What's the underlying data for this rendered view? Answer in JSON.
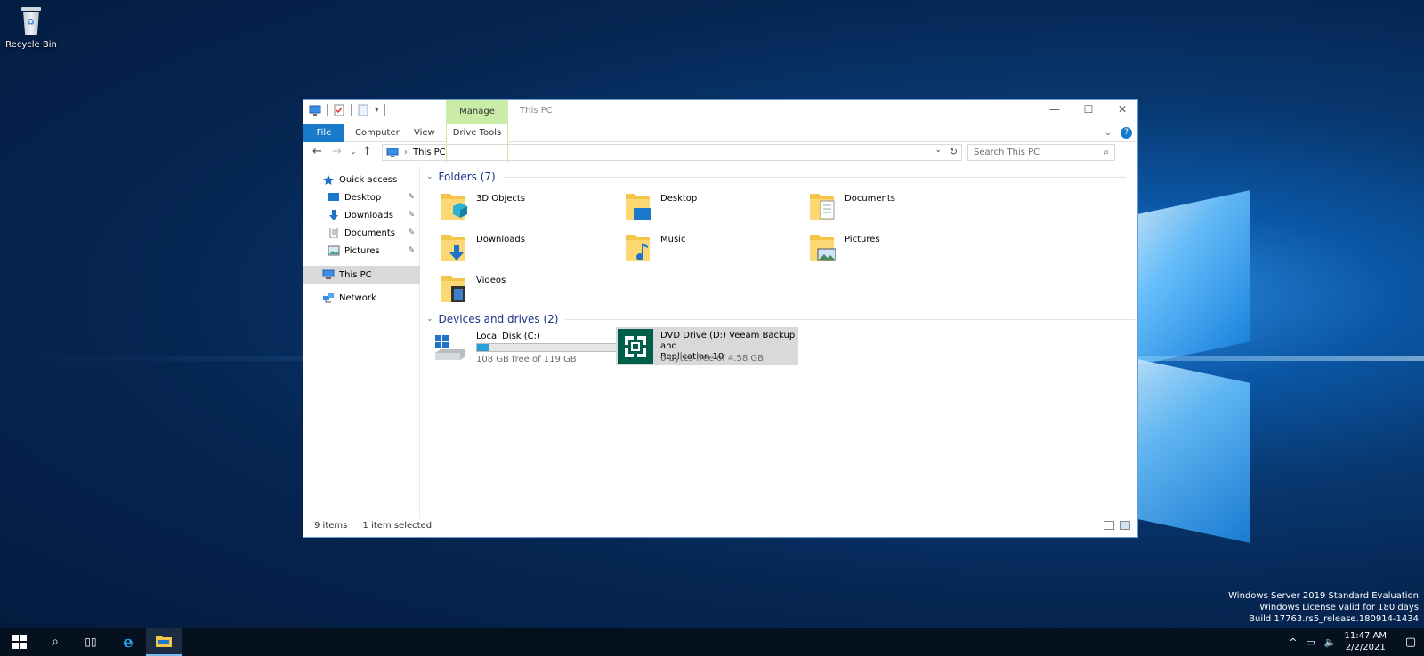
{
  "desktop": {
    "recycle_bin_label": "Recycle Bin",
    "watermark": {
      "line1": "Windows Server 2019 Standard Evaluation",
      "line2": "Windows License valid for 180 days",
      "line3": "Build 17763.rs5_release.180914-1434"
    }
  },
  "window": {
    "title": "This PC",
    "contextual_tab_group": "Manage",
    "ribbon_tabs": {
      "file": "File",
      "computer": "Computer",
      "view": "View",
      "drive_tools": "Drive Tools"
    },
    "controls": {
      "minimize": "—",
      "maximize": "☐",
      "close": "✕"
    }
  },
  "address_bar": {
    "path": "This PC",
    "search_placeholder": "Search This PC"
  },
  "nav_pane": {
    "quick_access": "Quick access",
    "pinned": [
      {
        "label": "Desktop"
      },
      {
        "label": "Downloads"
      },
      {
        "label": "Documents"
      },
      {
        "label": "Pictures"
      }
    ],
    "this_pc": "This PC",
    "network": "Network"
  },
  "content": {
    "folders_header": "Folders (7)",
    "folders": [
      {
        "name": "3D Objects",
        "icon": "3d-objects-folder-icon"
      },
      {
        "name": "Desktop",
        "icon": "desktop-folder-icon"
      },
      {
        "name": "Documents",
        "icon": "documents-folder-icon"
      },
      {
        "name": "Downloads",
        "icon": "downloads-folder-icon"
      },
      {
        "name": "Music",
        "icon": "music-folder-icon"
      },
      {
        "name": "Pictures",
        "icon": "pictures-folder-icon"
      },
      {
        "name": "Videos",
        "icon": "videos-folder-icon"
      }
    ],
    "devices_header": "Devices and drives (2)",
    "drives": [
      {
        "name": "Local Disk (C:)",
        "free_text": "108 GB free of 119 GB",
        "used_fraction": 0.092
      },
      {
        "name": "DVD Drive (D:) Veeam Backup and Replication 10",
        "name_line1": "DVD Drive (D:) Veeam Backup and",
        "name_line2": "Replication 10",
        "free_text": "0 bytes free of 4.58 GB"
      }
    ]
  },
  "status_bar": {
    "item_count": "9 items",
    "selection": "1 item selected"
  },
  "taskbar": {
    "time": "11:47 AM",
    "date": "2/2/2021"
  },
  "colors": {
    "accent": "#1979ca",
    "manage_tab": "#c9eda7",
    "veeam_green": "#005f4b",
    "selection": "#cce8ff"
  }
}
